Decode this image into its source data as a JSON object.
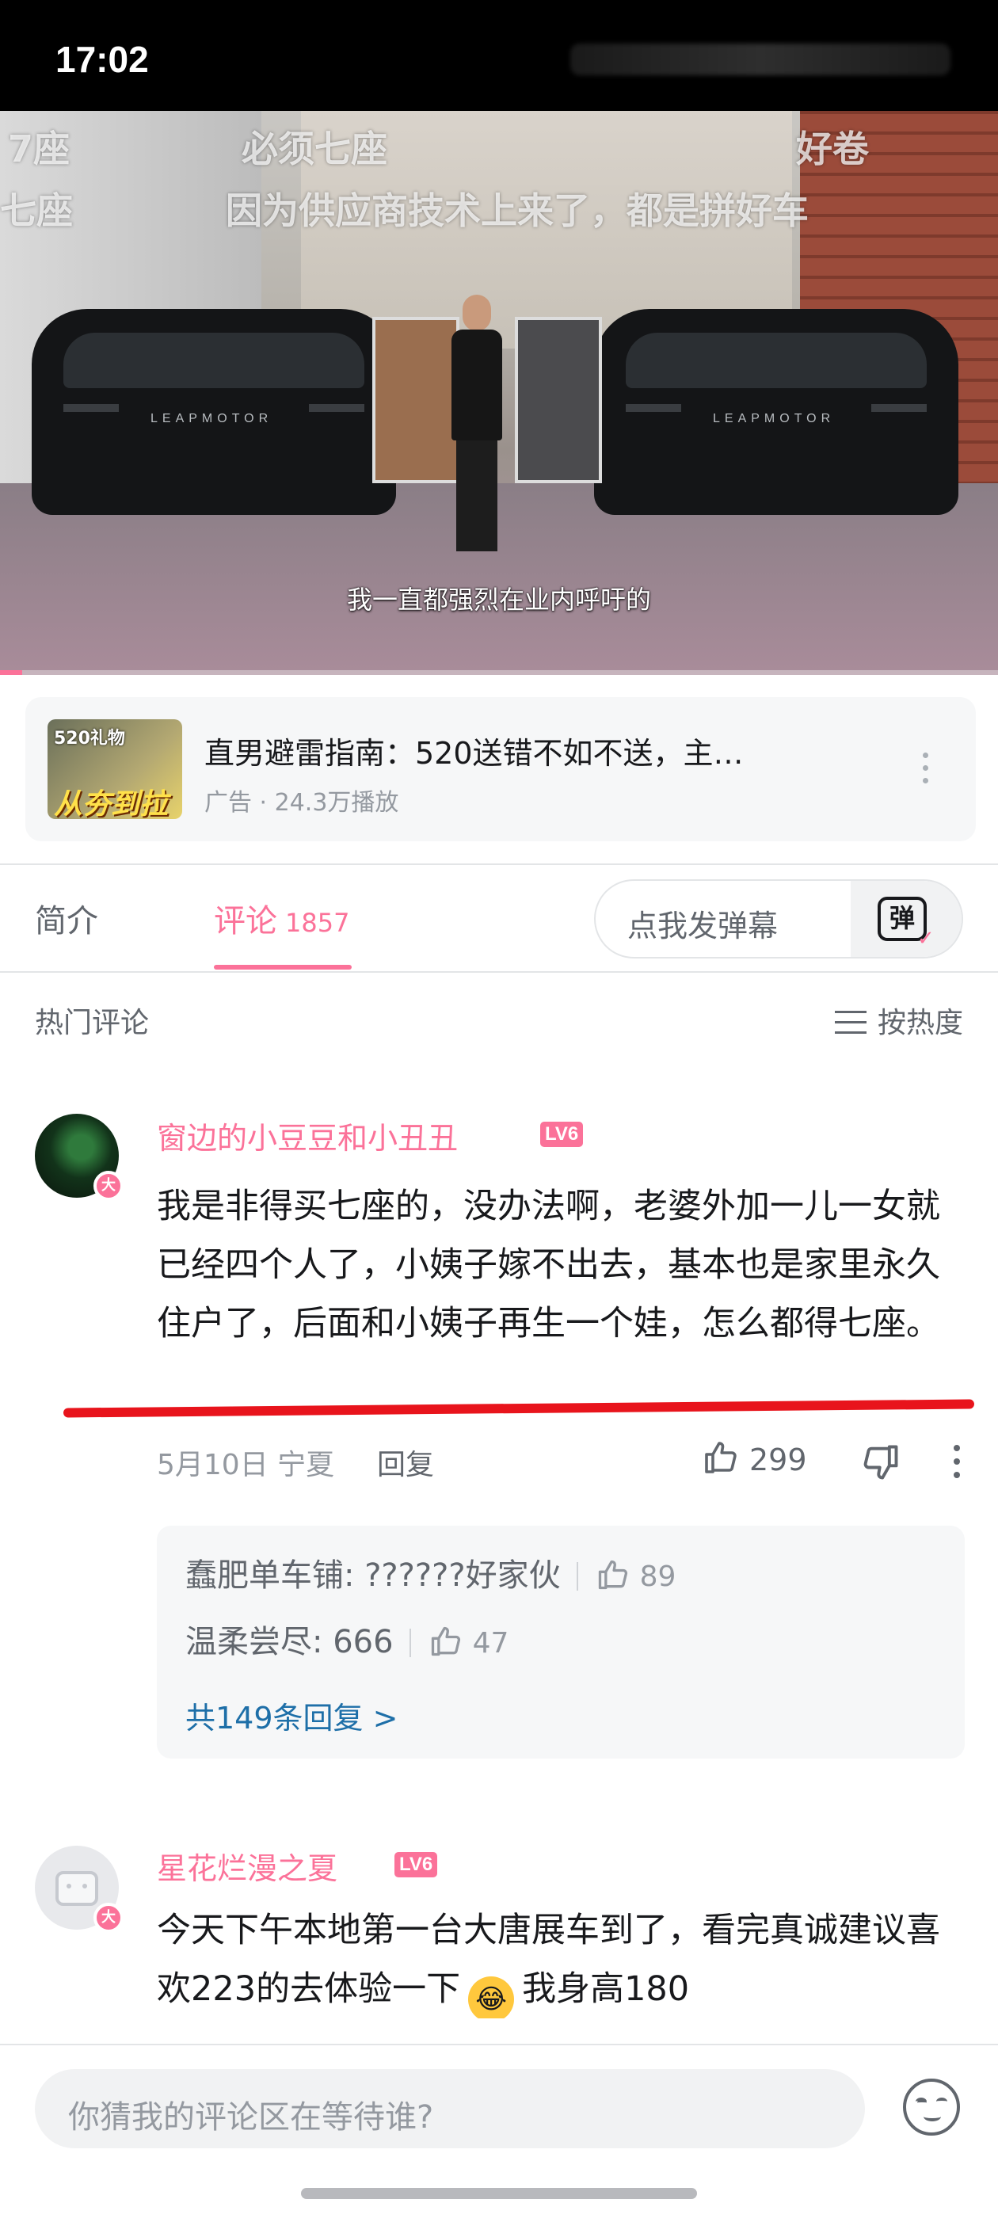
{
  "status": {
    "time": "17:02"
  },
  "video": {
    "overlay_texts": [
      "7座",
      "必须七座",
      "好卷",
      "七座",
      "因为供应商技术上来了，都是拼好车"
    ],
    "subtitle": "我一直都强烈在业内呼吁的",
    "car_badge": "LEAPMOTOR",
    "progress_fraction": 0.022
  },
  "ad": {
    "thumb_text_top": "520礼物",
    "thumb_text_bottom": "从夯到拉",
    "title": "直男避雷指南：520送错不如不送，主…",
    "meta": "广告 · 24.3万播放"
  },
  "tabs": {
    "intro": "简介",
    "comments": "评论",
    "comments_count": "1857",
    "danmaku_placeholder": "点我发弹幕",
    "danmaku_icon": "弹"
  },
  "comments_header": {
    "hot": "热门评论",
    "sort": "按热度"
  },
  "comments": [
    {
      "username": "窗边的小豆豆和小丑丑",
      "level": "LV6",
      "vip_badge": "大",
      "text": "我是非得买七座的，没办法啊，老婆外加一儿一女就已经四个人了，小姨子嫁不出去，基本也是家里永久住户了，后面和小姨子再生一个娃，怎么都得七座。",
      "date_location": "5月10日 宁夏",
      "reply_label": "回复",
      "likes": "299",
      "replies": [
        {
          "user": "蠢肥单车铺",
          "text": "??????好家伙",
          "likes": "89"
        },
        {
          "user": "温柔尝尽",
          "text": "666",
          "likes": "47"
        }
      ],
      "reply_total": "共149条回复 >"
    },
    {
      "username": "星花烂漫之夏",
      "level": "LV6",
      "vip_badge": "大",
      "text_a": "今天下午本地第一台大唐展车到了，看完真诚建议喜欢223的去体验一下",
      "text_b": "我身高180"
    }
  ],
  "bottom": {
    "placeholder": "你猜我的评论区在等待谁?"
  },
  "colors": {
    "accent": "#fb7299",
    "link": "#1e6fa8",
    "underline": "#e8141c"
  }
}
